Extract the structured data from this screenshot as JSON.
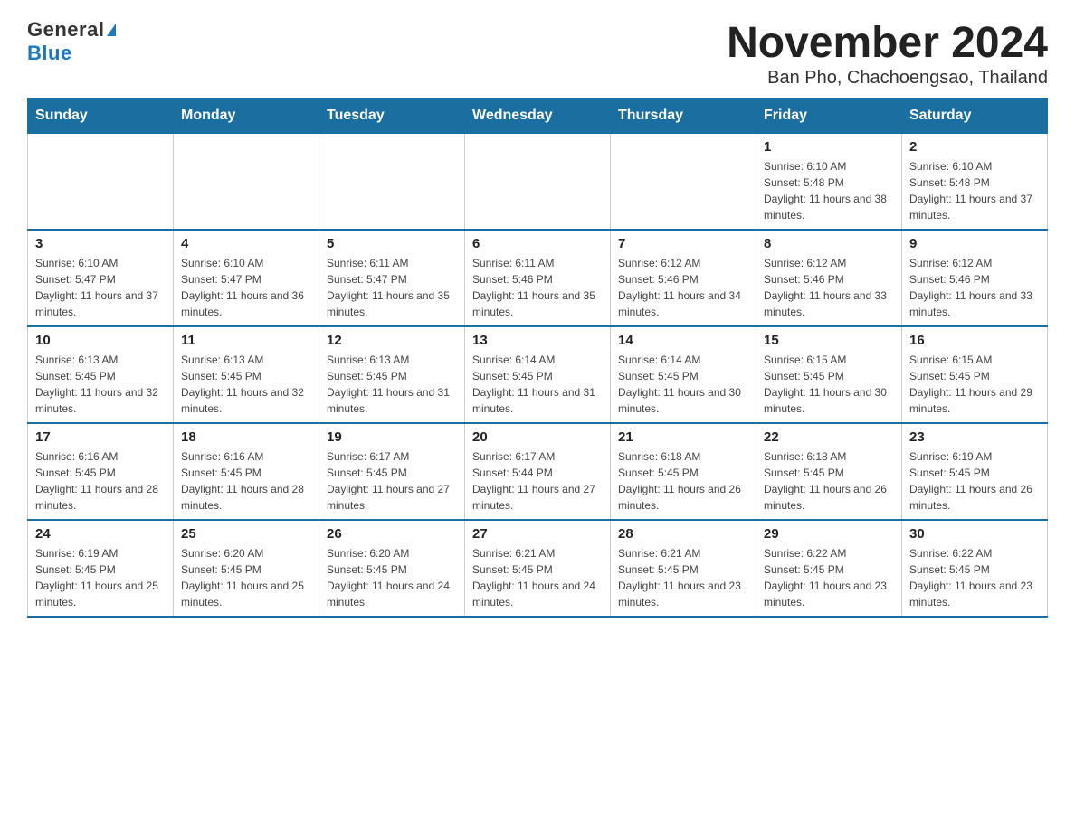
{
  "header": {
    "logo_general": "General",
    "logo_blue": "Blue",
    "title": "November 2024",
    "location": "Ban Pho, Chachoengsao, Thailand"
  },
  "weekdays": [
    "Sunday",
    "Monday",
    "Tuesday",
    "Wednesday",
    "Thursday",
    "Friday",
    "Saturday"
  ],
  "weeks": [
    [
      {
        "day": "",
        "info": ""
      },
      {
        "day": "",
        "info": ""
      },
      {
        "day": "",
        "info": ""
      },
      {
        "day": "",
        "info": ""
      },
      {
        "day": "",
        "info": ""
      },
      {
        "day": "1",
        "info": "Sunrise: 6:10 AM\nSunset: 5:48 PM\nDaylight: 11 hours and 38 minutes."
      },
      {
        "day": "2",
        "info": "Sunrise: 6:10 AM\nSunset: 5:48 PM\nDaylight: 11 hours and 37 minutes."
      }
    ],
    [
      {
        "day": "3",
        "info": "Sunrise: 6:10 AM\nSunset: 5:47 PM\nDaylight: 11 hours and 37 minutes."
      },
      {
        "day": "4",
        "info": "Sunrise: 6:10 AM\nSunset: 5:47 PM\nDaylight: 11 hours and 36 minutes."
      },
      {
        "day": "5",
        "info": "Sunrise: 6:11 AM\nSunset: 5:47 PM\nDaylight: 11 hours and 35 minutes."
      },
      {
        "day": "6",
        "info": "Sunrise: 6:11 AM\nSunset: 5:46 PM\nDaylight: 11 hours and 35 minutes."
      },
      {
        "day": "7",
        "info": "Sunrise: 6:12 AM\nSunset: 5:46 PM\nDaylight: 11 hours and 34 minutes."
      },
      {
        "day": "8",
        "info": "Sunrise: 6:12 AM\nSunset: 5:46 PM\nDaylight: 11 hours and 33 minutes."
      },
      {
        "day": "9",
        "info": "Sunrise: 6:12 AM\nSunset: 5:46 PM\nDaylight: 11 hours and 33 minutes."
      }
    ],
    [
      {
        "day": "10",
        "info": "Sunrise: 6:13 AM\nSunset: 5:45 PM\nDaylight: 11 hours and 32 minutes."
      },
      {
        "day": "11",
        "info": "Sunrise: 6:13 AM\nSunset: 5:45 PM\nDaylight: 11 hours and 32 minutes."
      },
      {
        "day": "12",
        "info": "Sunrise: 6:13 AM\nSunset: 5:45 PM\nDaylight: 11 hours and 31 minutes."
      },
      {
        "day": "13",
        "info": "Sunrise: 6:14 AM\nSunset: 5:45 PM\nDaylight: 11 hours and 31 minutes."
      },
      {
        "day": "14",
        "info": "Sunrise: 6:14 AM\nSunset: 5:45 PM\nDaylight: 11 hours and 30 minutes."
      },
      {
        "day": "15",
        "info": "Sunrise: 6:15 AM\nSunset: 5:45 PM\nDaylight: 11 hours and 30 minutes."
      },
      {
        "day": "16",
        "info": "Sunrise: 6:15 AM\nSunset: 5:45 PM\nDaylight: 11 hours and 29 minutes."
      }
    ],
    [
      {
        "day": "17",
        "info": "Sunrise: 6:16 AM\nSunset: 5:45 PM\nDaylight: 11 hours and 28 minutes."
      },
      {
        "day": "18",
        "info": "Sunrise: 6:16 AM\nSunset: 5:45 PM\nDaylight: 11 hours and 28 minutes."
      },
      {
        "day": "19",
        "info": "Sunrise: 6:17 AM\nSunset: 5:45 PM\nDaylight: 11 hours and 27 minutes."
      },
      {
        "day": "20",
        "info": "Sunrise: 6:17 AM\nSunset: 5:44 PM\nDaylight: 11 hours and 27 minutes."
      },
      {
        "day": "21",
        "info": "Sunrise: 6:18 AM\nSunset: 5:45 PM\nDaylight: 11 hours and 26 minutes."
      },
      {
        "day": "22",
        "info": "Sunrise: 6:18 AM\nSunset: 5:45 PM\nDaylight: 11 hours and 26 minutes."
      },
      {
        "day": "23",
        "info": "Sunrise: 6:19 AM\nSunset: 5:45 PM\nDaylight: 11 hours and 26 minutes."
      }
    ],
    [
      {
        "day": "24",
        "info": "Sunrise: 6:19 AM\nSunset: 5:45 PM\nDaylight: 11 hours and 25 minutes."
      },
      {
        "day": "25",
        "info": "Sunrise: 6:20 AM\nSunset: 5:45 PM\nDaylight: 11 hours and 25 minutes."
      },
      {
        "day": "26",
        "info": "Sunrise: 6:20 AM\nSunset: 5:45 PM\nDaylight: 11 hours and 24 minutes."
      },
      {
        "day": "27",
        "info": "Sunrise: 6:21 AM\nSunset: 5:45 PM\nDaylight: 11 hours and 24 minutes."
      },
      {
        "day": "28",
        "info": "Sunrise: 6:21 AM\nSunset: 5:45 PM\nDaylight: 11 hours and 23 minutes."
      },
      {
        "day": "29",
        "info": "Sunrise: 6:22 AM\nSunset: 5:45 PM\nDaylight: 11 hours and 23 minutes."
      },
      {
        "day": "30",
        "info": "Sunrise: 6:22 AM\nSunset: 5:45 PM\nDaylight: 11 hours and 23 minutes."
      }
    ]
  ]
}
